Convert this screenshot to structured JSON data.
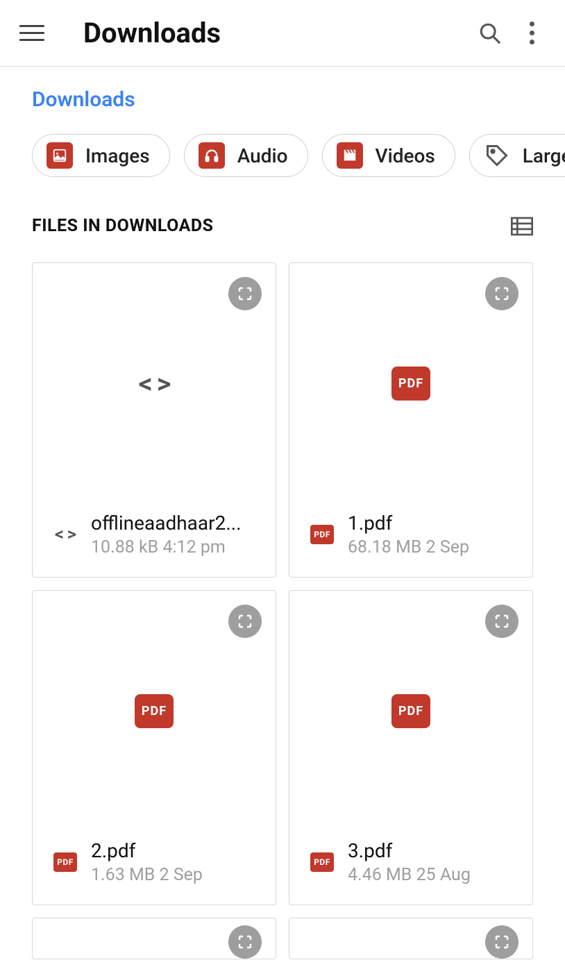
{
  "header": {
    "title": "Downloads"
  },
  "breadcrumb": {
    "path": "Downloads"
  },
  "filters": {
    "items": [
      {
        "label": "Images",
        "icon": "image"
      },
      {
        "label": "Audio",
        "icon": "headphones"
      },
      {
        "label": "Videos",
        "icon": "clapper"
      },
      {
        "label": "Large",
        "icon": "tag"
      }
    ]
  },
  "section": {
    "title": "FILES IN DOWNLOADS"
  },
  "files": [
    {
      "name": "offlineaadhaar2...",
      "size": "10.88 kB",
      "date": "4:12 pm",
      "type": "code",
      "preview": "code"
    },
    {
      "name": "1.pdf",
      "size": "68.18 MB",
      "date": "2 Sep",
      "type": "pdf",
      "preview": "pdf"
    },
    {
      "name": "2.pdf",
      "size": "1.63 MB",
      "date": "2 Sep",
      "type": "pdf",
      "preview": "pdf"
    },
    {
      "name": "3.pdf",
      "size": "4.46 MB",
      "date": "25 Aug",
      "type": "pdf",
      "preview": "pdf"
    }
  ],
  "labels": {
    "pdf": "PDF"
  }
}
